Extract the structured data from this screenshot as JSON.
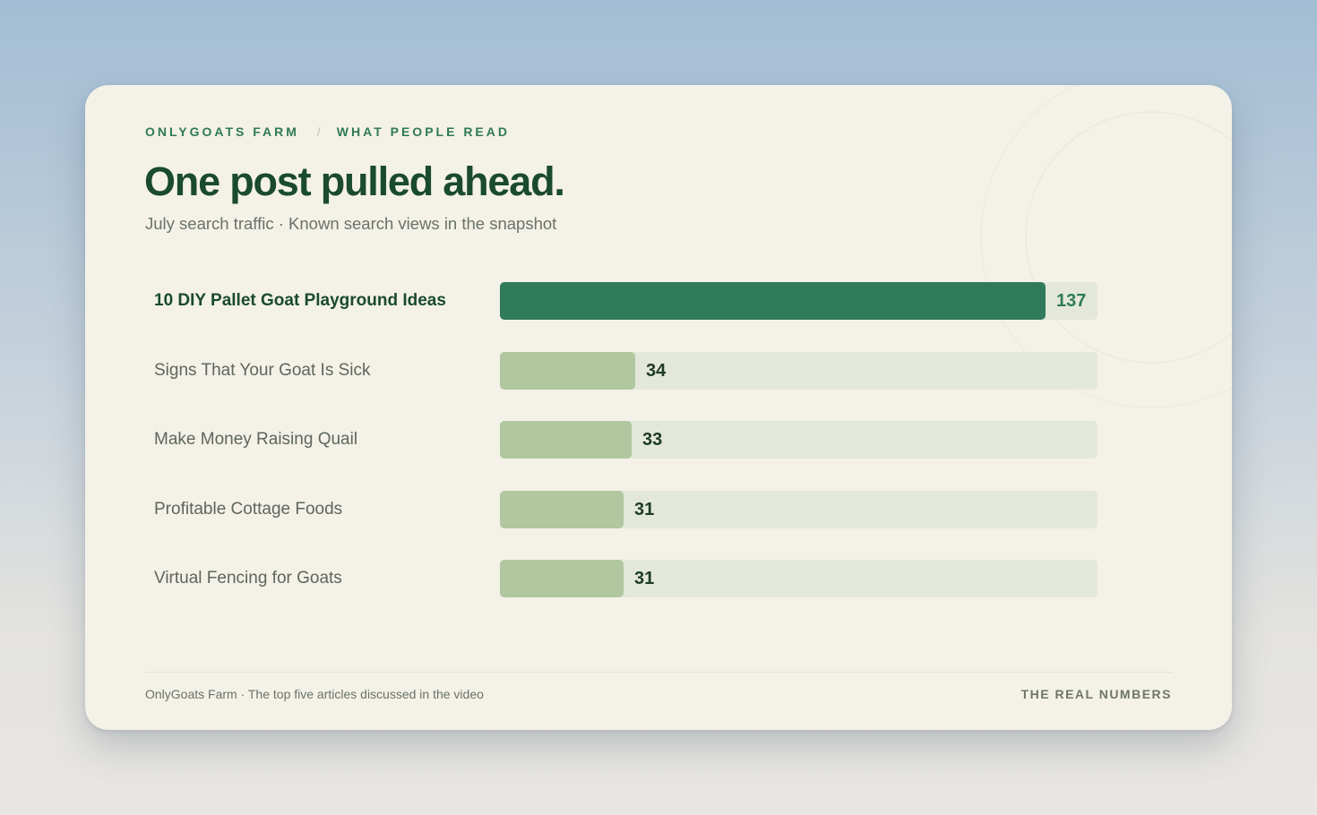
{
  "header": {
    "brand": "ONLYGOATS FARM",
    "separator": "/",
    "section": "WHAT PEOPLE READ",
    "title": "One post pulled ahead.",
    "subtitle": "July search traffic · Known search views in the snapshot"
  },
  "colors": {
    "accent": "#2f7a5a",
    "secondary_bar": "#b0c79f",
    "track": "#e4e8da",
    "card": "#f3f1e8",
    "title": "#1a4a30"
  },
  "chart_data": {
    "type": "bar",
    "orientation": "horizontal",
    "categories": [
      "10 DIY Pallet Goat Playground Ideas",
      "Signs That Your Goat Is Sick",
      "Make Money Raising Quail",
      "Profitable Cottage Foods",
      "Virtual Fencing for Goats"
    ],
    "values": [
      137,
      34,
      33,
      31,
      31
    ],
    "value_labels": [
      "137",
      "34",
      "33",
      "31",
      "31"
    ],
    "highlighted_index": 0,
    "xlim": [
      0,
      150
    ],
    "grid": false,
    "legend": "none"
  },
  "footer": {
    "source": "OnlyGoats Farm · The top five articles discussed in the video",
    "tag": "THE REAL NUMBERS"
  }
}
